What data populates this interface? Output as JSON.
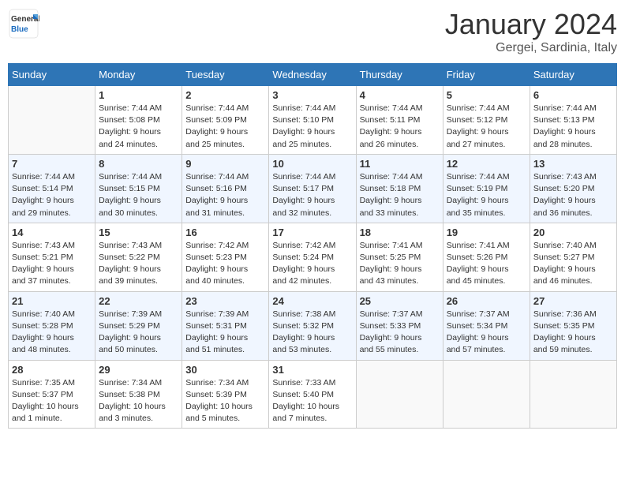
{
  "header": {
    "logo_general": "General",
    "logo_blue": "Blue",
    "title": "January 2024",
    "location": "Gergei, Sardinia, Italy"
  },
  "calendar": {
    "days_of_week": [
      "Sunday",
      "Monday",
      "Tuesday",
      "Wednesday",
      "Thursday",
      "Friday",
      "Saturday"
    ],
    "weeks": [
      [
        {
          "day": "",
          "info": ""
        },
        {
          "day": "1",
          "info": "Sunrise: 7:44 AM\nSunset: 5:08 PM\nDaylight: 9 hours\nand 24 minutes."
        },
        {
          "day": "2",
          "info": "Sunrise: 7:44 AM\nSunset: 5:09 PM\nDaylight: 9 hours\nand 25 minutes."
        },
        {
          "day": "3",
          "info": "Sunrise: 7:44 AM\nSunset: 5:10 PM\nDaylight: 9 hours\nand 25 minutes."
        },
        {
          "day": "4",
          "info": "Sunrise: 7:44 AM\nSunset: 5:11 PM\nDaylight: 9 hours\nand 26 minutes."
        },
        {
          "day": "5",
          "info": "Sunrise: 7:44 AM\nSunset: 5:12 PM\nDaylight: 9 hours\nand 27 minutes."
        },
        {
          "day": "6",
          "info": "Sunrise: 7:44 AM\nSunset: 5:13 PM\nDaylight: 9 hours\nand 28 minutes."
        }
      ],
      [
        {
          "day": "7",
          "info": "Sunrise: 7:44 AM\nSunset: 5:14 PM\nDaylight: 9 hours\nand 29 minutes."
        },
        {
          "day": "8",
          "info": "Sunrise: 7:44 AM\nSunset: 5:15 PM\nDaylight: 9 hours\nand 30 minutes."
        },
        {
          "day": "9",
          "info": "Sunrise: 7:44 AM\nSunset: 5:16 PM\nDaylight: 9 hours\nand 31 minutes."
        },
        {
          "day": "10",
          "info": "Sunrise: 7:44 AM\nSunset: 5:17 PM\nDaylight: 9 hours\nand 32 minutes."
        },
        {
          "day": "11",
          "info": "Sunrise: 7:44 AM\nSunset: 5:18 PM\nDaylight: 9 hours\nand 33 minutes."
        },
        {
          "day": "12",
          "info": "Sunrise: 7:44 AM\nSunset: 5:19 PM\nDaylight: 9 hours\nand 35 minutes."
        },
        {
          "day": "13",
          "info": "Sunrise: 7:43 AM\nSunset: 5:20 PM\nDaylight: 9 hours\nand 36 minutes."
        }
      ],
      [
        {
          "day": "14",
          "info": "Sunrise: 7:43 AM\nSunset: 5:21 PM\nDaylight: 9 hours\nand 37 minutes."
        },
        {
          "day": "15",
          "info": "Sunrise: 7:43 AM\nSunset: 5:22 PM\nDaylight: 9 hours\nand 39 minutes."
        },
        {
          "day": "16",
          "info": "Sunrise: 7:42 AM\nSunset: 5:23 PM\nDaylight: 9 hours\nand 40 minutes."
        },
        {
          "day": "17",
          "info": "Sunrise: 7:42 AM\nSunset: 5:24 PM\nDaylight: 9 hours\nand 42 minutes."
        },
        {
          "day": "18",
          "info": "Sunrise: 7:41 AM\nSunset: 5:25 PM\nDaylight: 9 hours\nand 43 minutes."
        },
        {
          "day": "19",
          "info": "Sunrise: 7:41 AM\nSunset: 5:26 PM\nDaylight: 9 hours\nand 45 minutes."
        },
        {
          "day": "20",
          "info": "Sunrise: 7:40 AM\nSunset: 5:27 PM\nDaylight: 9 hours\nand 46 minutes."
        }
      ],
      [
        {
          "day": "21",
          "info": "Sunrise: 7:40 AM\nSunset: 5:28 PM\nDaylight: 9 hours\nand 48 minutes."
        },
        {
          "day": "22",
          "info": "Sunrise: 7:39 AM\nSunset: 5:29 PM\nDaylight: 9 hours\nand 50 minutes."
        },
        {
          "day": "23",
          "info": "Sunrise: 7:39 AM\nSunset: 5:31 PM\nDaylight: 9 hours\nand 51 minutes."
        },
        {
          "day": "24",
          "info": "Sunrise: 7:38 AM\nSunset: 5:32 PM\nDaylight: 9 hours\nand 53 minutes."
        },
        {
          "day": "25",
          "info": "Sunrise: 7:37 AM\nSunset: 5:33 PM\nDaylight: 9 hours\nand 55 minutes."
        },
        {
          "day": "26",
          "info": "Sunrise: 7:37 AM\nSunset: 5:34 PM\nDaylight: 9 hours\nand 57 minutes."
        },
        {
          "day": "27",
          "info": "Sunrise: 7:36 AM\nSunset: 5:35 PM\nDaylight: 9 hours\nand 59 minutes."
        }
      ],
      [
        {
          "day": "28",
          "info": "Sunrise: 7:35 AM\nSunset: 5:37 PM\nDaylight: 10 hours\nand 1 minute."
        },
        {
          "day": "29",
          "info": "Sunrise: 7:34 AM\nSunset: 5:38 PM\nDaylight: 10 hours\nand 3 minutes."
        },
        {
          "day": "30",
          "info": "Sunrise: 7:34 AM\nSunset: 5:39 PM\nDaylight: 10 hours\nand 5 minutes."
        },
        {
          "day": "31",
          "info": "Sunrise: 7:33 AM\nSunset: 5:40 PM\nDaylight: 10 hours\nand 7 minutes."
        },
        {
          "day": "",
          "info": ""
        },
        {
          "day": "",
          "info": ""
        },
        {
          "day": "",
          "info": ""
        }
      ]
    ]
  }
}
